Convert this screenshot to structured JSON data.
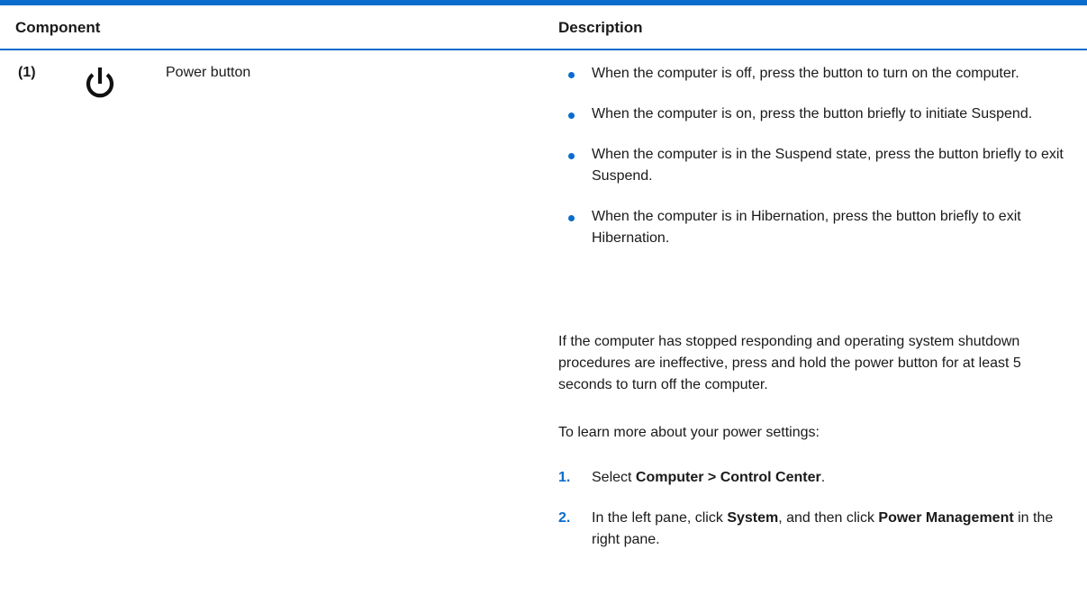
{
  "table": {
    "header": {
      "component": "Component",
      "description": "Description"
    },
    "row": {
      "number": "(1)",
      "icon": "power-icon",
      "component_name": "Power button",
      "bullets": [
        "When the computer is off, press the button to turn on the computer.",
        "When the computer is on, press the button briefly to initiate Suspend.",
        "When the computer is in the Suspend state, press the button briefly to exit Suspend.",
        "When the computer is in Hibernation, press the button briefly to exit Hibernation."
      ],
      "paragraph_1": "If the computer has stopped responding and operating system shutdown procedures are ineffective, press and hold the power button for at least 5 seconds to turn off the computer.",
      "paragraph_2": "To learn more about your power settings:",
      "steps": [
        {
          "num": "1.",
          "pre": "Select ",
          "bold": "Computer > Control Center",
          "post": "."
        },
        {
          "num": "2.",
          "pre": "In the left pane, click ",
          "bold": "System",
          "mid": ", and then click ",
          "bold2": "Power Management",
          "post": " in the right pane."
        }
      ]
    }
  },
  "colors": {
    "accent": "#0a6ccc",
    "text": "#1a1a1a"
  }
}
